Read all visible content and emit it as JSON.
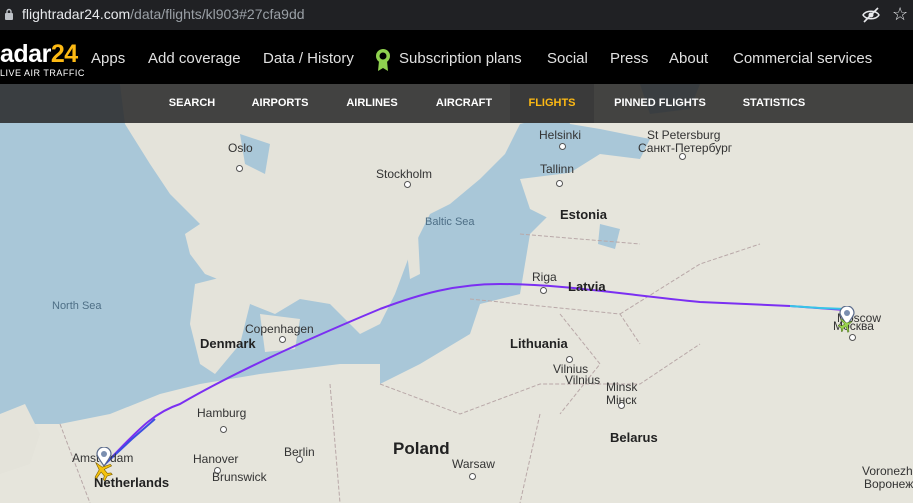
{
  "browser": {
    "url_host": "flightradar24.com",
    "url_path": "/data/flights/kl903#27cfa9dd",
    "star_glyph": "☆"
  },
  "header": {
    "logo_text_a": "adar",
    "logo_text_b": "24",
    "logo_tagline": "LIVE AIR TRAFFIC",
    "nav": {
      "apps": "Apps",
      "add_coverage": "Add coverage",
      "data_history": "Data / History",
      "subscription": "Subscription plans",
      "social": "Social",
      "press": "Press",
      "about": "About",
      "commercial": "Commercial services"
    }
  },
  "subnav": {
    "search": "SEARCH",
    "airports": "AIRPORTS",
    "airlines": "AIRLINES",
    "aircraft": "AIRCRAFT",
    "flights": "FLIGHTS",
    "pinned": "PINNED FLIGHTS",
    "statistics": "STATISTICS"
  },
  "map": {
    "labels": {
      "helsinki": "Helsinki",
      "st_petersburg": "St Petersburg",
      "st_petersburg_ru": "Санкт-Петербург",
      "oslo": "Oslo",
      "stockholm": "Stockholm",
      "tallinn": "Tallinn",
      "estonia": "Estonia",
      "baltic_sea": "Baltic Sea",
      "riga": "Riga",
      "latvia": "Latvia",
      "north_sea": "North Sea",
      "moscow": "Moscow",
      "moscow_ru": "Москва",
      "copenhagen": "Copenhagen",
      "denmark": "Denmark",
      "lithuania": "Lithuania",
      "vilnius": "Vilnius",
      "vilnius_alt": "Vilnius",
      "minsk": "Minsk",
      "minsk_ru": "Мінск",
      "belarus": "Belarus",
      "hamburg": "Hamburg",
      "amsterdam": "Amsterdam",
      "netherlands": "Netherlands",
      "hanover": "Hanover",
      "brunswick": "Brunswick",
      "berlin": "Berlin",
      "poland": "Poland",
      "warsaw": "Warsaw",
      "voronezh": "Voronezh",
      "voronezh_ru": "Воронеж"
    },
    "colors": {
      "water": "#a9c7d8",
      "land": "#e6e5dc",
      "route_main": "#7b2ff2",
      "route_start": "#3b4fe0",
      "route_end": "#36c5e8",
      "aircraft": "#f4c20d"
    }
  }
}
